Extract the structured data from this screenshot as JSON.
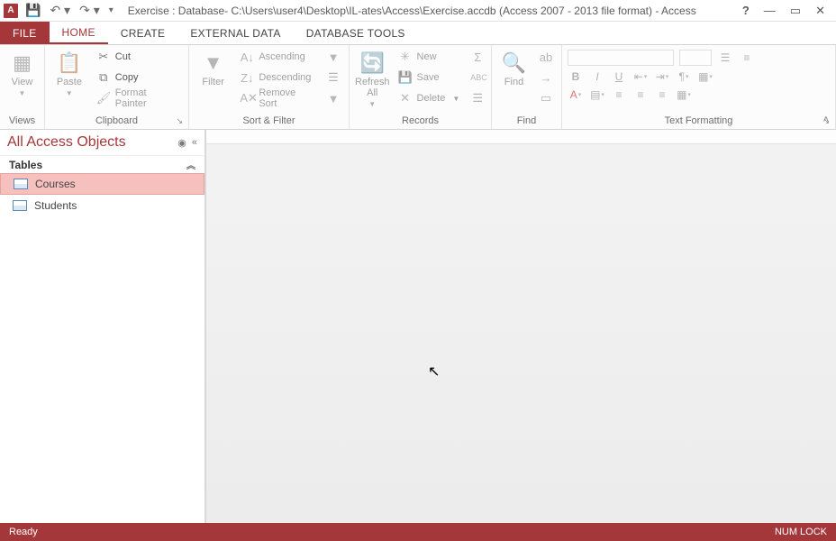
{
  "titlebar": {
    "title": "Exercise : Database- C:\\Users\\user4\\Desktop\\IL-ates\\Access\\Exercise.accdb (Access 2007 - 2013 file format) - Access"
  },
  "tabs": {
    "file": "FILE",
    "home": "HOME",
    "create": "CREATE",
    "external": "EXTERNAL DATA",
    "dbtools": "DATABASE TOOLS"
  },
  "ribbon": {
    "views": {
      "view": "View",
      "label": "Views"
    },
    "clipboard": {
      "paste": "Paste",
      "cut": "Cut",
      "copy": "Copy",
      "format_painter": "Format Painter",
      "label": "Clipboard"
    },
    "sortfilter": {
      "filter": "Filter",
      "asc": "Ascending",
      "desc": "Descending",
      "remove": "Remove Sort",
      "label": "Sort & Filter"
    },
    "records": {
      "refresh": "Refresh All",
      "new": "New",
      "save": "Save",
      "delete": "Delete",
      "label": "Records"
    },
    "find": {
      "find": "Find",
      "label": "Find"
    },
    "textfmt": {
      "label": "Text Formatting"
    }
  },
  "navpane": {
    "title": "All Access Objects",
    "tables_header": "Tables",
    "items": [
      {
        "label": "Courses",
        "selected": true
      },
      {
        "label": "Students",
        "selected": false
      }
    ]
  },
  "statusbar": {
    "left": "Ready",
    "right": "NUM LOCK"
  }
}
